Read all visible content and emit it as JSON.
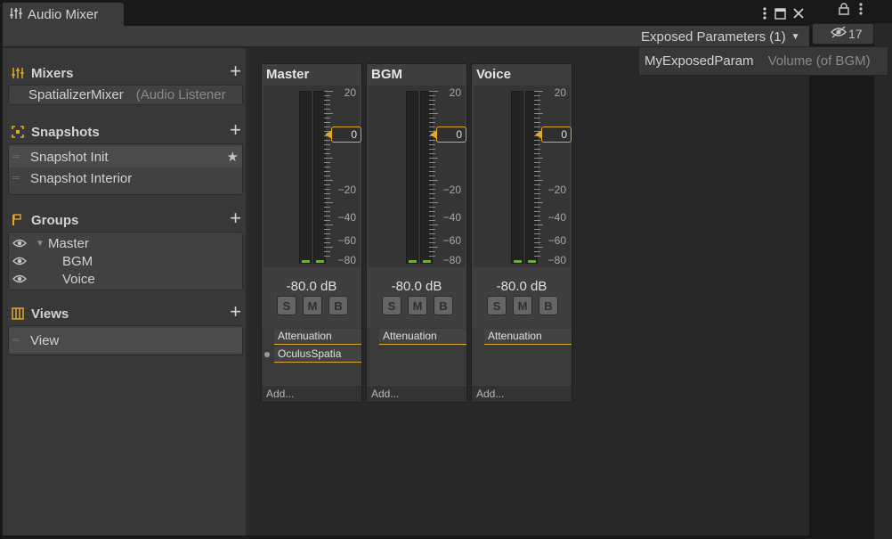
{
  "window": {
    "title": "Audio Mixer"
  },
  "toolbar": {
    "exposed_label": "Exposed Parameters (1)",
    "hidden_count": "17"
  },
  "exposed_popup": {
    "param_name": "MyExposedParam",
    "param_target": "Volume (of BGM)"
  },
  "mixers": {
    "title": "Mixers",
    "items": [
      {
        "name": "SpatializerMixer",
        "detail": "(Audio Listener"
      }
    ]
  },
  "snapshots": {
    "title": "Snapshots",
    "items": [
      {
        "name": "Snapshot Init",
        "selected": true
      },
      {
        "name": "Snapshot Interior",
        "selected": false
      }
    ]
  },
  "groups": {
    "title": "Groups",
    "items": [
      {
        "name": "Master"
      },
      {
        "name": "BGM"
      },
      {
        "name": "Voice"
      }
    ]
  },
  "views": {
    "title": "Views",
    "items": [
      {
        "name": "View"
      }
    ]
  },
  "scale": {
    "top": "20",
    "zero": "0",
    "m20": "−20",
    "m40": "−40",
    "m60": "−60",
    "m80": "−80"
  },
  "strips": [
    {
      "name": "Master",
      "db": "-80.0 dB",
      "level": 0.0,
      "effects": [
        "Attenuation",
        "OculusSpatia"
      ],
      "add": "Add..."
    },
    {
      "name": "BGM",
      "db": "-80.0 dB",
      "level": 0.0,
      "effects": [
        "Attenuation"
      ],
      "add": "Add..."
    },
    {
      "name": "Voice",
      "db": "-80.0 dB",
      "level": 0.0,
      "effects": [
        "Attenuation"
      ],
      "add": "Add..."
    }
  ],
  "buttons": {
    "solo": "S",
    "mute": "M",
    "bypass": "B"
  },
  "colors": {
    "accent": "#e0a92a",
    "meter": "#6fae34"
  }
}
